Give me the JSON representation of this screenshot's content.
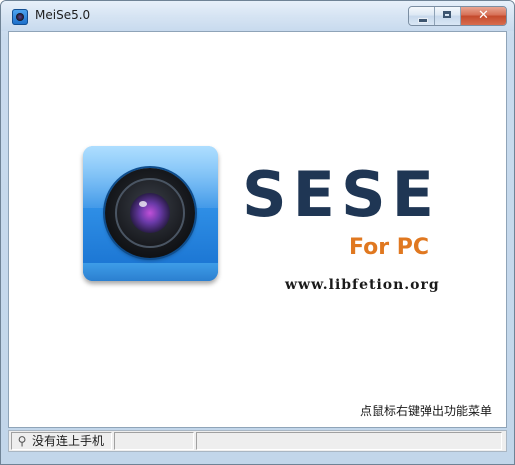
{
  "window": {
    "title": "MeiSe5.0"
  },
  "caption_buttons": {
    "minimize_icon": "minimize-icon",
    "maximize_icon": "maximize-icon",
    "close_glyph": "✕"
  },
  "main": {
    "brand": "SESE",
    "brand_sub": "For PC",
    "url": "www.libfetion.org",
    "hint": "点鼠标右键弹出功能菜单",
    "logo_icon": "camera-lens-icon"
  },
  "statusbar": {
    "usb_icon": "usb-icon",
    "connection_status": "没有连上手机"
  },
  "colors": {
    "brand_text": "#1f3654",
    "brand_sub": "#e07820",
    "logo_blue": "#2f8fe6",
    "close_button": "#c44a2c"
  }
}
